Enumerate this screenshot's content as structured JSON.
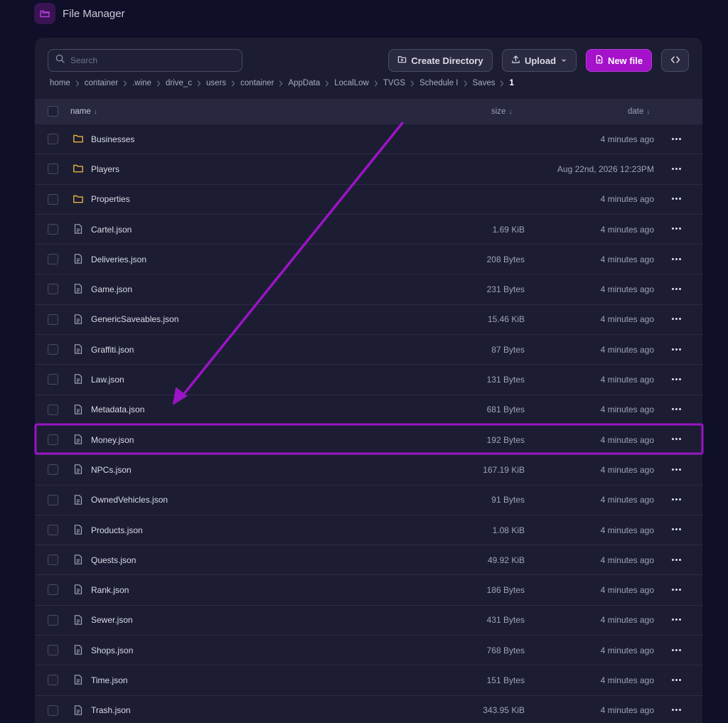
{
  "app": {
    "title": "File Manager"
  },
  "toolbar": {
    "search_placeholder": "Search",
    "create_directory": "Create Directory",
    "upload": "Upload",
    "new_file": "New file"
  },
  "breadcrumb": [
    "home",
    "container",
    ".wine",
    "drive_c",
    "users",
    "container",
    "AppData",
    "LocalLow",
    "TVGS",
    "Schedule I",
    "Saves",
    "1"
  ],
  "table": {
    "headers": {
      "name": "name",
      "size": "size",
      "date": "date"
    },
    "rows": [
      {
        "type": "folder",
        "name": "Businesses",
        "size": "",
        "date": "4 minutes ago"
      },
      {
        "type": "folder",
        "name": "Players",
        "size": "",
        "date": "Aug 22nd, 2026 12:23PM"
      },
      {
        "type": "folder",
        "name": "Properties",
        "size": "",
        "date": "4 minutes ago"
      },
      {
        "type": "file",
        "name": "Cartel.json",
        "size": "1.69 KiB",
        "date": "4 minutes ago"
      },
      {
        "type": "file",
        "name": "Deliveries.json",
        "size": "208 Bytes",
        "date": "4 minutes ago"
      },
      {
        "type": "file",
        "name": "Game.json",
        "size": "231 Bytes",
        "date": "4 minutes ago"
      },
      {
        "type": "file",
        "name": "GenericSaveables.json",
        "size": "15.46 KiB",
        "date": "4 minutes ago"
      },
      {
        "type": "file",
        "name": "Graffiti.json",
        "size": "87 Bytes",
        "date": "4 minutes ago"
      },
      {
        "type": "file",
        "name": "Law.json",
        "size": "131 Bytes",
        "date": "4 minutes ago"
      },
      {
        "type": "file",
        "name": "Metadata.json",
        "size": "681 Bytes",
        "date": "4 minutes ago"
      },
      {
        "type": "file",
        "name": "Money.json",
        "size": "192 Bytes",
        "date": "4 minutes ago"
      },
      {
        "type": "file",
        "name": "NPCs.json",
        "size": "167.19 KiB",
        "date": "4 minutes ago"
      },
      {
        "type": "file",
        "name": "OwnedVehicles.json",
        "size": "91 Bytes",
        "date": "4 minutes ago"
      },
      {
        "type": "file",
        "name": "Products.json",
        "size": "1.08 KiB",
        "date": "4 minutes ago"
      },
      {
        "type": "file",
        "name": "Quests.json",
        "size": "49.92 KiB",
        "date": "4 minutes ago"
      },
      {
        "type": "file",
        "name": "Rank.json",
        "size": "186 Bytes",
        "date": "4 minutes ago"
      },
      {
        "type": "file",
        "name": "Sewer.json",
        "size": "431 Bytes",
        "date": "4 minutes ago"
      },
      {
        "type": "file",
        "name": "Shops.json",
        "size": "768 Bytes",
        "date": "4 minutes ago"
      },
      {
        "type": "file",
        "name": "Time.json",
        "size": "151 Bytes",
        "date": "4 minutes ago"
      },
      {
        "type": "file",
        "name": "Trash.json",
        "size": "343.95 KiB",
        "date": "4 minutes ago"
      }
    ]
  },
  "highlight": {
    "row": "Money.json",
    "color": "#9b14c4"
  },
  "colors": {
    "accent": "#a412c9",
    "folder": "#e3b23c",
    "background": "#0f0f29",
    "panel": "#1c1d33"
  }
}
